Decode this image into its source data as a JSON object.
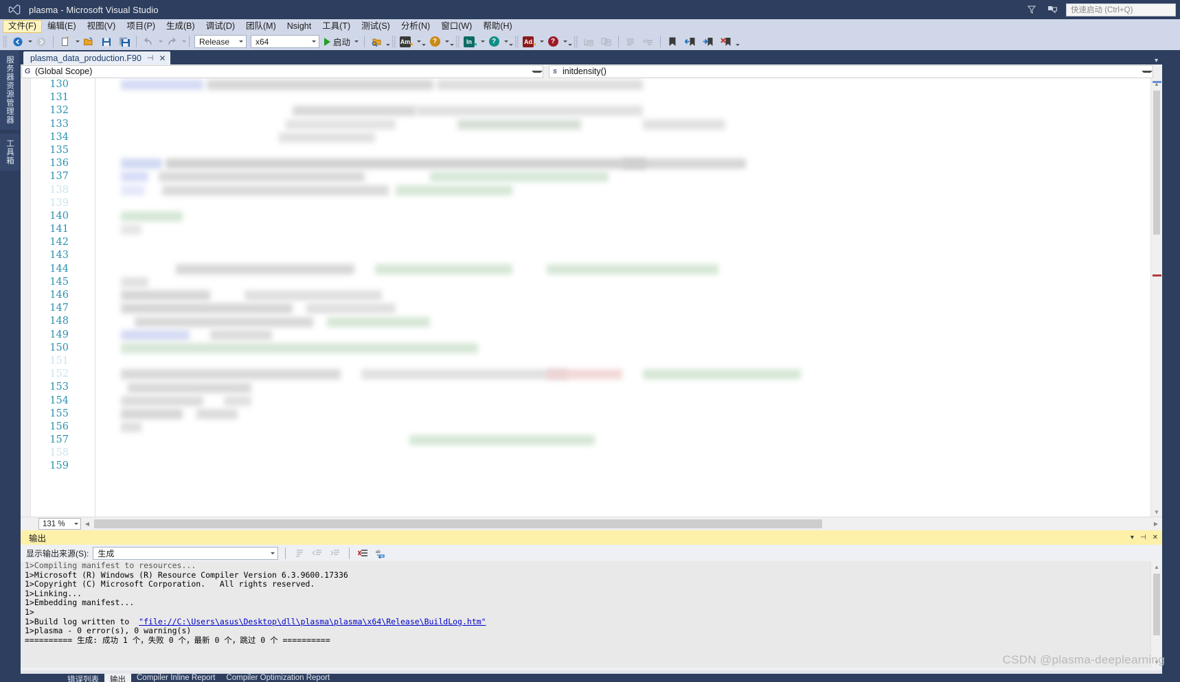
{
  "window": {
    "title": "plasma - Microsoft Visual Studio",
    "logo_icon": "visual-studio-logo"
  },
  "titlebar_right": {
    "filter_icon": "filter-icon",
    "feedback_icon": "feedback-icon",
    "quick_launch_placeholder": "快速启动 (Ctrl+Q)"
  },
  "menubar": {
    "items": [
      {
        "label": "文件(F)",
        "active": true
      },
      {
        "label": "编辑(E)",
        "active": false
      },
      {
        "label": "视图(V)",
        "active": false
      },
      {
        "label": "项目(P)",
        "active": false
      },
      {
        "label": "生成(B)",
        "active": false
      },
      {
        "label": "调试(D)",
        "active": false
      },
      {
        "label": "团队(M)",
        "active": false
      },
      {
        "label": "Nsight",
        "active": false
      },
      {
        "label": "工具(T)",
        "active": false
      },
      {
        "label": "测试(S)",
        "active": false
      },
      {
        "label": "分析(N)",
        "active": false
      },
      {
        "label": "窗口(W)",
        "active": false
      },
      {
        "label": "帮助(H)",
        "active": false
      }
    ]
  },
  "toolbar": {
    "nav_back_icon": "navigate-back-icon",
    "nav_forward_icon": "navigate-forward-icon",
    "new_item_icon": "new-item-icon",
    "open_file_icon": "open-file-icon",
    "save_icon": "save-icon",
    "save_all_icon": "save-all-icon",
    "undo_icon": "undo-icon",
    "redo_icon": "redo-icon",
    "config_value": "Release",
    "platform_value": "x64",
    "start_label": "启动",
    "start_icon": "play-icon",
    "attach_icon": "attach-to-process-icon",
    "amplifier_icon": "amplifier-icon",
    "amplifier_help_icon": "amplifier-help-icon",
    "inspector_icon": "inspector-icon",
    "inspector_help_icon": "inspector-help-icon",
    "advisor_icon": "advisor-icon",
    "advisor_help_icon": "advisor-help-icon",
    "indent_icon": "indent-icon",
    "outdent_icon": "outdent-icon",
    "comment_icon": "comment-icon",
    "uncomment_icon": "uncomment-icon",
    "bookmark_icon": "bookmark-icon",
    "prev_bookmark_icon": "previous-bookmark-icon",
    "next_bookmark_icon": "next-bookmark-icon",
    "clear_bookmarks_icon": "clear-bookmarks-icon"
  },
  "left_rail": {
    "tabs": [
      "服务器资源管理器",
      "工具箱"
    ]
  },
  "editor": {
    "tab_label": "plasma_data_production.F90",
    "tab_pin_icon": "pin-icon",
    "tab_close_icon": "close-icon",
    "scope_icon": "G",
    "scope_value": "(Global Scope)",
    "member_icon": "s",
    "member_value": "initdensity()",
    "line_start": 130,
    "line_numbers": [
      130,
      131,
      132,
      133,
      134,
      135,
      136,
      137,
      138,
      139,
      140,
      141,
      142,
      143,
      144,
      145,
      146,
      147,
      148,
      149,
      150,
      151,
      152,
      153,
      154,
      155,
      156,
      157,
      158,
      159
    ],
    "zoom_level": "131 %"
  },
  "output": {
    "panel_title": "输出",
    "minimize_icon": "minimize-icon",
    "pin_icon": "pin-icon",
    "close_icon": "close-icon",
    "source_label": "显示输出来源(S):",
    "source_value": "生成",
    "go_to_icon": "goto-message-icon",
    "prev_icon": "previous-message-icon",
    "next_icon": "next-message-icon",
    "clear_icon": "clear-all-icon",
    "wordwrap_icon": "toggle-word-wrap-icon",
    "lines": [
      {
        "text": "1>Compiling manifest to resources...",
        "type": "faded"
      },
      {
        "text": "1>Microsoft (R) Windows (R) Resource Compiler Version 6.3.9600.17336",
        "type": "plain"
      },
      {
        "text": "1>Copyright (C) Microsoft Corporation.   All rights reserved.",
        "type": "plain"
      },
      {
        "text": "1>Linking...",
        "type": "plain"
      },
      {
        "text": "1>Embedding manifest...",
        "type": "plain"
      },
      {
        "text": "1>",
        "type": "plain"
      },
      {
        "text": "1>Build log written to  ",
        "type": "link",
        "link": "\"file://C:\\Users\\asus\\Desktop\\dll\\plasma\\plasma\\x64\\Release\\BuildLog.htm\""
      },
      {
        "text": "1>plasma - 0 error(s), 0 warning(s)",
        "type": "plain"
      },
      {
        "text": "========== 生成: 成功 1 个，失败 0 个，最新 0 个，跳过 0 个 ==========",
        "type": "plain"
      }
    ]
  },
  "bottom_tabs": {
    "items": [
      {
        "label": "错误列表",
        "selected": false
      },
      {
        "label": "输出",
        "selected": true
      },
      {
        "label": "Compiler Inline Report",
        "selected": false
      },
      {
        "label": "Compiler Optimization Report",
        "selected": false
      }
    ]
  },
  "watermark": {
    "text": "CSDN @plasma-deeplearning"
  },
  "colors": {
    "chrome": "#2d3e5f",
    "menu_bg": "#d0d7e8",
    "output_title": "#fdf0a8",
    "linenum": "#2b91af",
    "accent_green": "#21a121",
    "link": "#0000c8"
  }
}
